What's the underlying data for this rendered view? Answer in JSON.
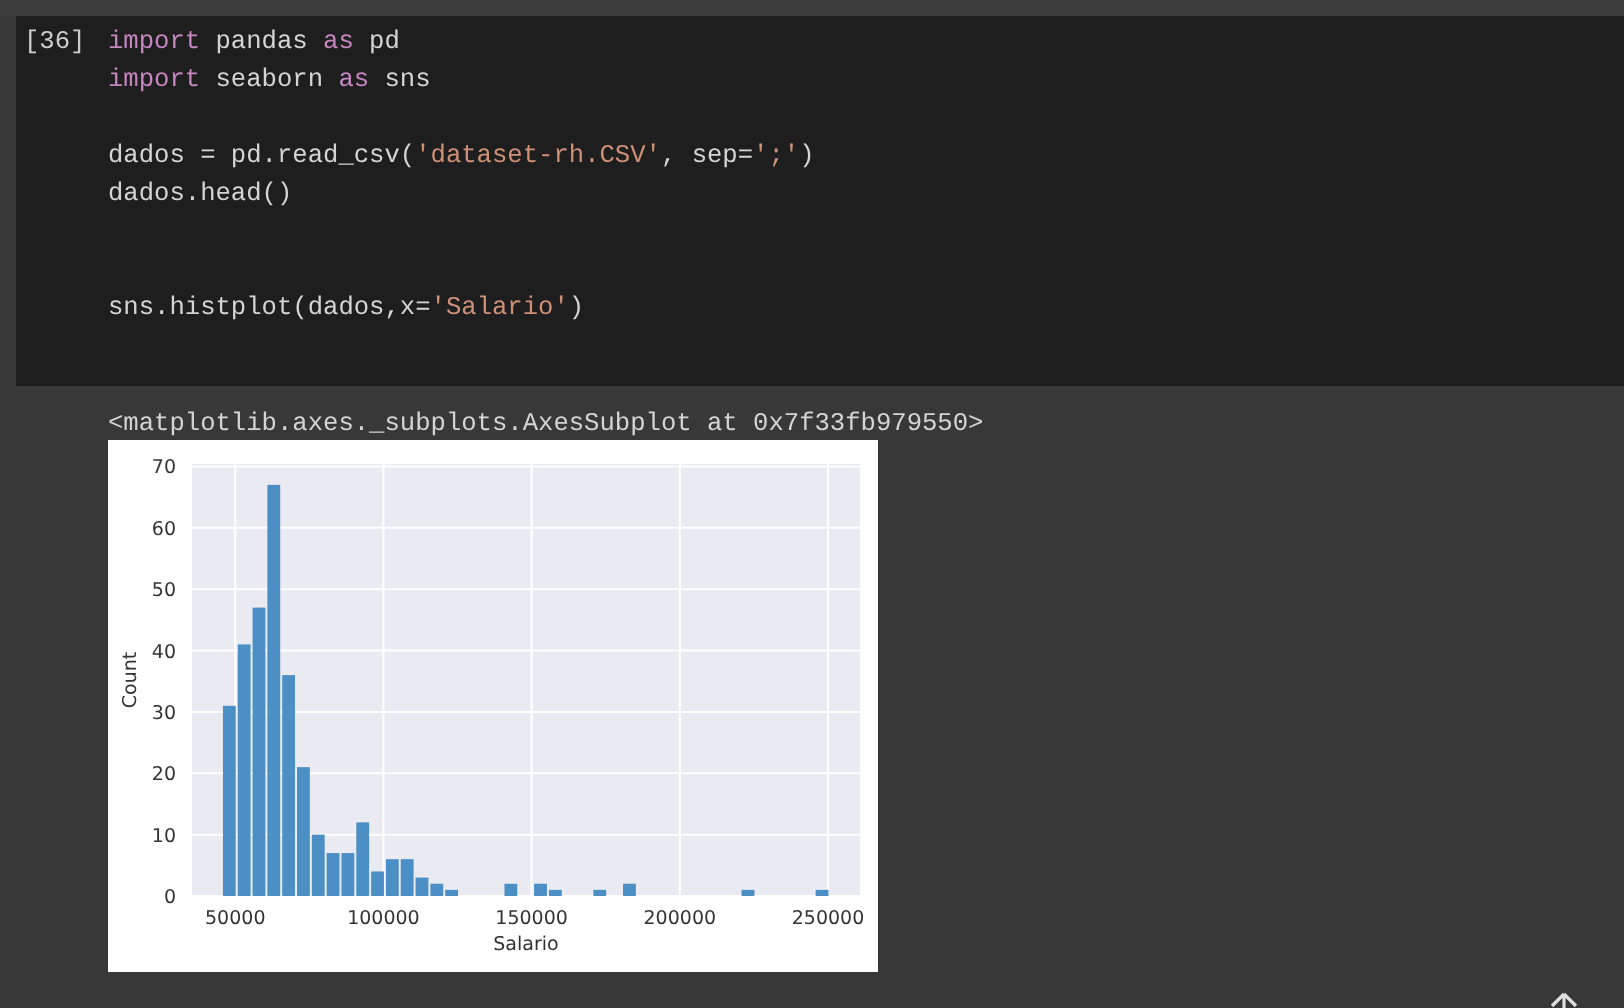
{
  "cell": {
    "execution_count": "[36]",
    "code_tokens": [
      {
        "text": "import",
        "kind": "keyword"
      },
      {
        "text": " pandas ",
        "kind": "plain"
      },
      {
        "text": "as",
        "kind": "keyword"
      },
      {
        "text": " pd\n",
        "kind": "plain"
      },
      {
        "text": "import",
        "kind": "keyword"
      },
      {
        "text": " seaborn ",
        "kind": "plain"
      },
      {
        "text": "as",
        "kind": "keyword"
      },
      {
        "text": " sns\n\ndados = pd.read_csv(",
        "kind": "plain"
      },
      {
        "text": "'dataset-rh.CSV'",
        "kind": "string"
      },
      {
        "text": ", sep=",
        "kind": "plain"
      },
      {
        "text": "';'",
        "kind": "string"
      },
      {
        "text": ")\ndados.head()\n\n\nsns.histplot(dados,x=",
        "kind": "plain"
      },
      {
        "text": "'Salario'",
        "kind": "string"
      },
      {
        "text": ")",
        "kind": "plain"
      }
    ]
  },
  "output": {
    "text": "<matplotlib.axes._subplots.AxesSubplot at 0x7f33fb979550>",
    "chart_data": {
      "type": "bar",
      "xlabel": "Salario",
      "ylabel": "Count",
      "x": [
        48000,
        53000,
        58000,
        63000,
        68000,
        73000,
        78000,
        83000,
        88000,
        93000,
        98000,
        103000,
        108000,
        113000,
        118000,
        123000,
        128000,
        133000,
        138000,
        143000,
        148000,
        153000,
        158000,
        163000,
        168000,
        173000,
        178000,
        183000,
        188000,
        193000,
        198000,
        203000,
        208000,
        213000,
        218000,
        223000,
        228000,
        233000,
        238000,
        243000,
        248000
      ],
      "grid": true,
      "series": [
        {
          "color": "#4c8fc4",
          "values": [
            31,
            41,
            47,
            67,
            36,
            21,
            10,
            7,
            7,
            12,
            4,
            6,
            6,
            3,
            2,
            1,
            0,
            0,
            0,
            2,
            0,
            2,
            1,
            0,
            0,
            1,
            0,
            2,
            0,
            0,
            0,
            0,
            0,
            0,
            0,
            1,
            0,
            0,
            0,
            0,
            1
          ]
        }
      ],
      "xlim": [
        35400,
        260800
      ],
      "ylim": [
        0,
        70.4
      ],
      "xticks": [
        50000,
        100000,
        150000,
        200000,
        250000
      ],
      "yticks": [
        0,
        10,
        20,
        30,
        40,
        50,
        60,
        70
      ]
    }
  }
}
